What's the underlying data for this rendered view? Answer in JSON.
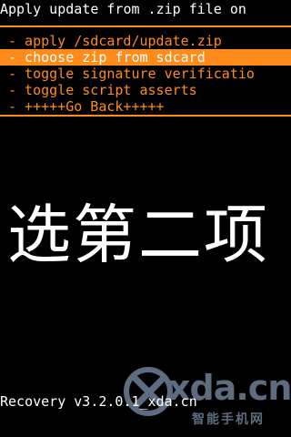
{
  "header": {
    "title": "Apply update from .zip file on"
  },
  "menu": {
    "items": [
      {
        "label": "- apply /sdcard/update.zip",
        "selected": false
      },
      {
        "label": "- choose zip from sdcard",
        "selected": true
      },
      {
        "label": "- toggle signature verificatio",
        "selected": false
      },
      {
        "label": "- toggle script asserts",
        "selected": false
      },
      {
        "label": "- +++++Go Back+++++",
        "selected": false
      }
    ]
  },
  "overlay": {
    "caption": "选第二项"
  },
  "footer": {
    "version": "Recovery v3.2.0.1_xda.cn"
  },
  "watermark": {
    "logo_text": "xda.cn",
    "subtitle": "智能手机网",
    "icon": "xda-logo-icon"
  },
  "colors": {
    "background": "#000000",
    "accent": "#ff8c1a",
    "text": "#ffffff",
    "watermark": "#a9c6e8"
  }
}
